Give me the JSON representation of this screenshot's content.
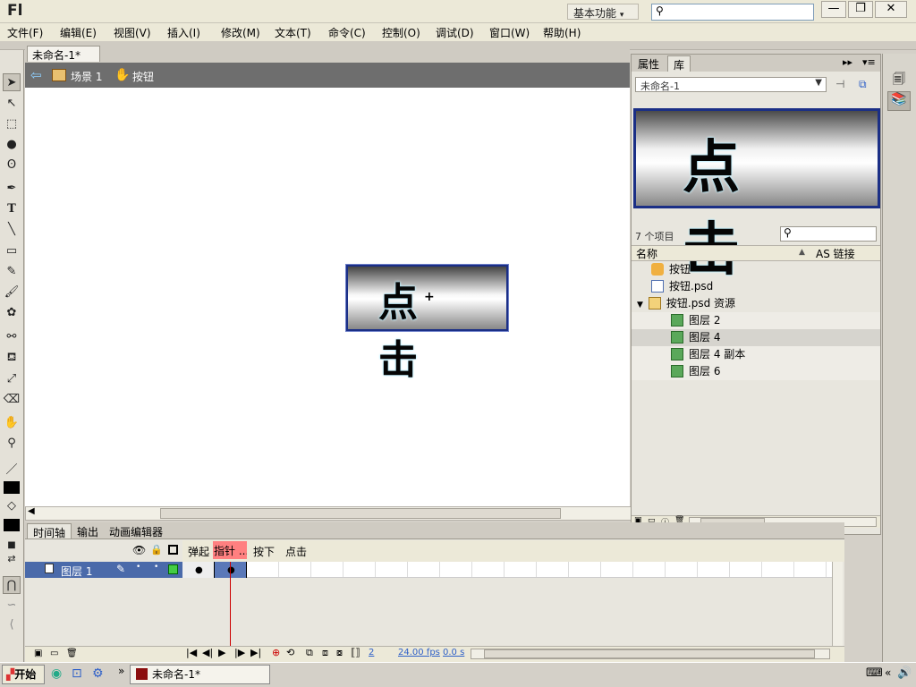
{
  "app": {
    "logo": "Fl",
    "workspace": "基本功能"
  },
  "window_controls": {
    "minimize": "—",
    "restore": "❐",
    "close": "✕"
  },
  "menu": [
    "文件(F)",
    "编辑(E)",
    "视图(V)",
    "插入(I)",
    "修改(M)",
    "文本(T)",
    "命令(C)",
    "控制(O)",
    "调试(D)",
    "窗口(W)",
    "帮助(H)"
  ],
  "document": {
    "tab": "未命名-1*",
    "close": "×"
  },
  "editbar": {
    "scene": "场景 1",
    "symbol": "按钮"
  },
  "stage": {
    "button_text": "点 击",
    "registration": "+"
  },
  "library": {
    "tabs": [
      "属性",
      "库"
    ],
    "doc_select": "未命名-1",
    "preview_text": "点 击",
    "item_count": "7 个项目",
    "col_name": "名称",
    "col_as": "AS 链接",
    "items": [
      {
        "label": "按钮",
        "icon": "button-symbol-icon"
      },
      {
        "label": "按钮.psd",
        "icon": "psd-file-icon"
      },
      {
        "label": "按钮.psd 资源",
        "icon": "folder-open-icon"
      },
      {
        "label": "图层 2",
        "icon": "bitmap-icon"
      },
      {
        "label": "图层 4",
        "icon": "bitmap-icon"
      },
      {
        "label": "图层 4 副本",
        "icon": "bitmap-icon"
      },
      {
        "label": "图层 6",
        "icon": "bitmap-icon"
      }
    ]
  },
  "timeline": {
    "tabs": [
      "时间轴",
      "输出",
      "动画编辑器"
    ],
    "frame_labels": [
      "弹起",
      "指针 ...",
      "按下",
      "点击"
    ],
    "layer": "图层 1",
    "current_frame": "2",
    "fps": "24.00 fps",
    "time": "0.0 s"
  },
  "taskbar": {
    "start": "开始",
    "window": "未命名-1*"
  },
  "colors": {
    "frame_highlight": "#ff8080",
    "layer_selected": "#4a6aaa",
    "button_border": "#1b2f86",
    "playhead": "#cc0000"
  }
}
